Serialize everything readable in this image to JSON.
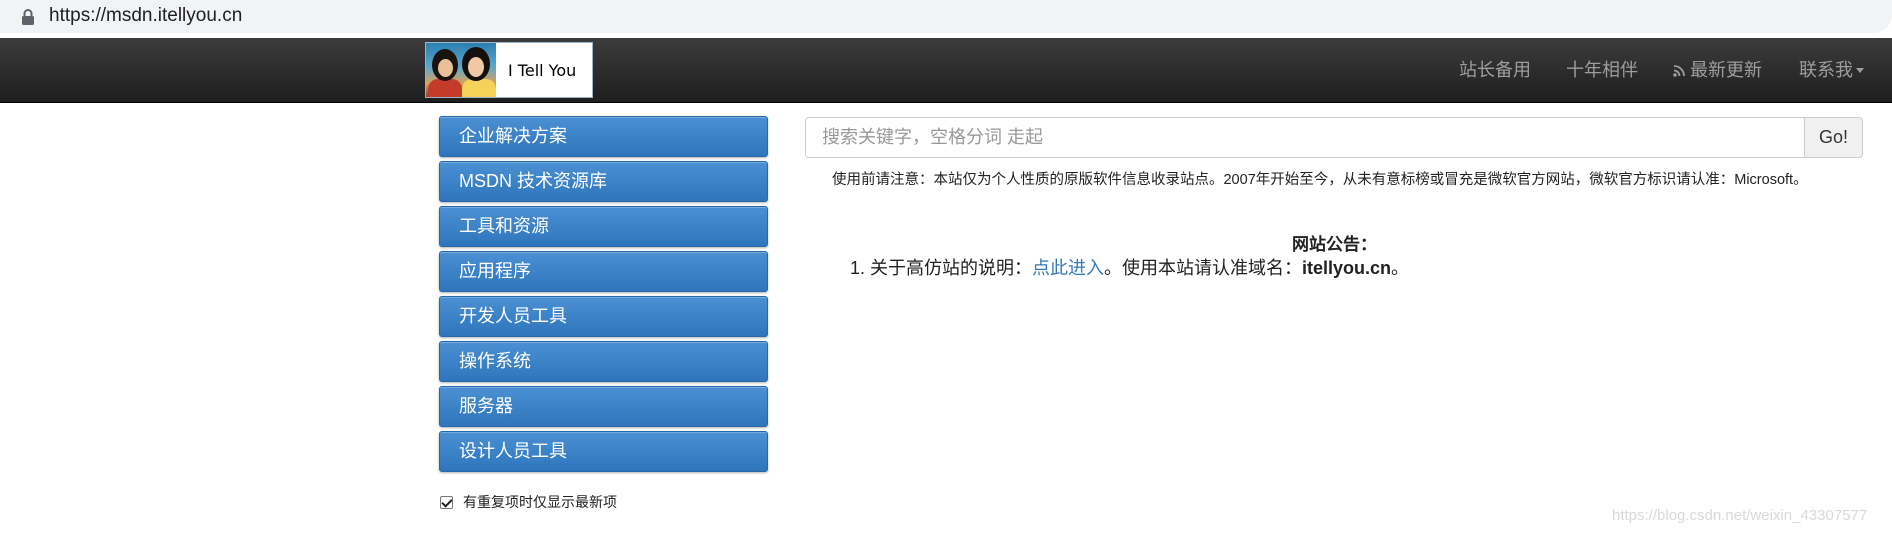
{
  "browser": {
    "url": "https://msdn.itellyou.cn"
  },
  "header": {
    "logo_text": "I Tell You",
    "nav": [
      {
        "label": "站长备用"
      },
      {
        "label": "十年相伴"
      },
      {
        "label": "最新更新",
        "icon": "rss-icon"
      },
      {
        "label": "联系我",
        "icon": "caret-down-icon"
      }
    ]
  },
  "sidebar": {
    "items": [
      {
        "label": "企业解决方案"
      },
      {
        "label": "MSDN 技术资源库"
      },
      {
        "label": "工具和资源"
      },
      {
        "label": "应用程序"
      },
      {
        "label": "开发人员工具"
      },
      {
        "label": "操作系统"
      },
      {
        "label": "服务器"
      },
      {
        "label": "设计人员工具"
      }
    ],
    "dedupe_label": "有重复项时仅显示最新项",
    "dedupe_checked": true
  },
  "search": {
    "placeholder": "搜索关键字，空格分词 走起",
    "button": "Go!"
  },
  "notice": "使用前请注意：本站仅为个人性质的原版软件信息收录站点。2007年开始至今，从未有意标榜或冒充是微软官方网站，微软官方标识请认准：Microsoft。",
  "announcement": {
    "title": "网站公告：",
    "item_prefix": "1. 关于高仿站的说明：",
    "item_link": "点此进入",
    "item_middle": "。使用本站请认准域名：",
    "item_domain": "itellyou.cn",
    "item_suffix": "。"
  },
  "watermark": "https://blog.csdn.net/weixin_43307577",
  "colors": {
    "navbar": "#222222",
    "button": "#337ab7",
    "link": "#337ab7"
  }
}
